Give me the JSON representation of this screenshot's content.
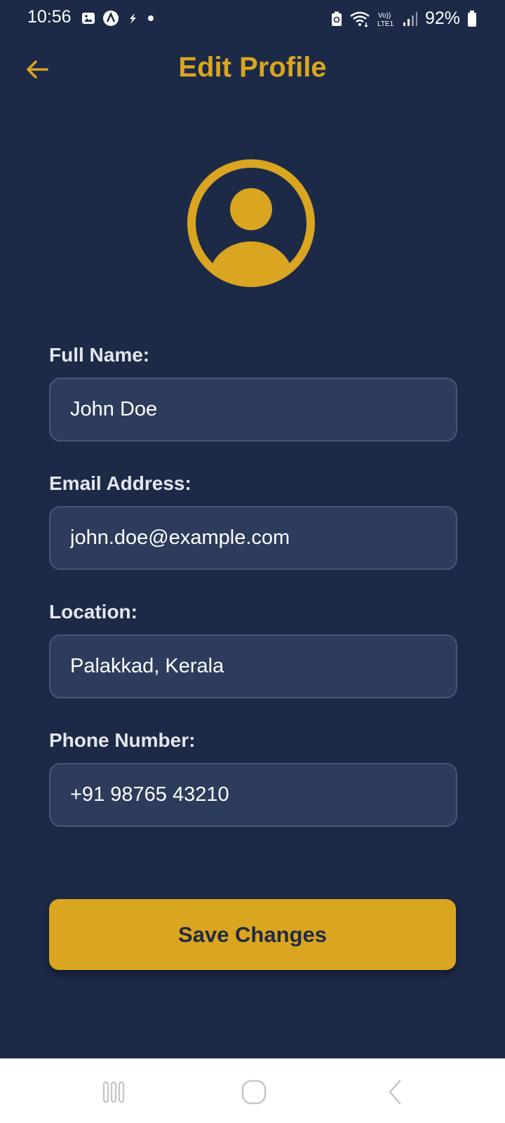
{
  "status_bar": {
    "time": "10:56",
    "battery": "92%",
    "icons": [
      "image-icon",
      "app-a-icon",
      "bolt-icon",
      "dot-icon",
      "battery-saver-icon",
      "wifi-icon",
      "volte-icon",
      "signal-icon",
      "battery-icon"
    ]
  },
  "header": {
    "title": "Edit Profile",
    "back_icon": "arrow-left-icon"
  },
  "avatar": {
    "icon": "user-avatar-icon"
  },
  "form": {
    "full_name": {
      "label": "Full Name:",
      "value": "John Doe"
    },
    "email": {
      "label": "Email Address:",
      "value": "john.doe@example.com"
    },
    "location": {
      "label": "Location:",
      "value": "Palakkad, Kerala"
    },
    "phone": {
      "label": "Phone Number:",
      "value": "+91 98765 43210"
    }
  },
  "save_button": {
    "label": "Save Changes"
  },
  "nav_bar": {
    "icons": [
      "recents-icon",
      "home-icon",
      "back-icon"
    ]
  },
  "colors": {
    "background": "#1c2a47",
    "accent": "#daa520",
    "input_bg": "#2d3c5c",
    "input_border": "#465677"
  }
}
